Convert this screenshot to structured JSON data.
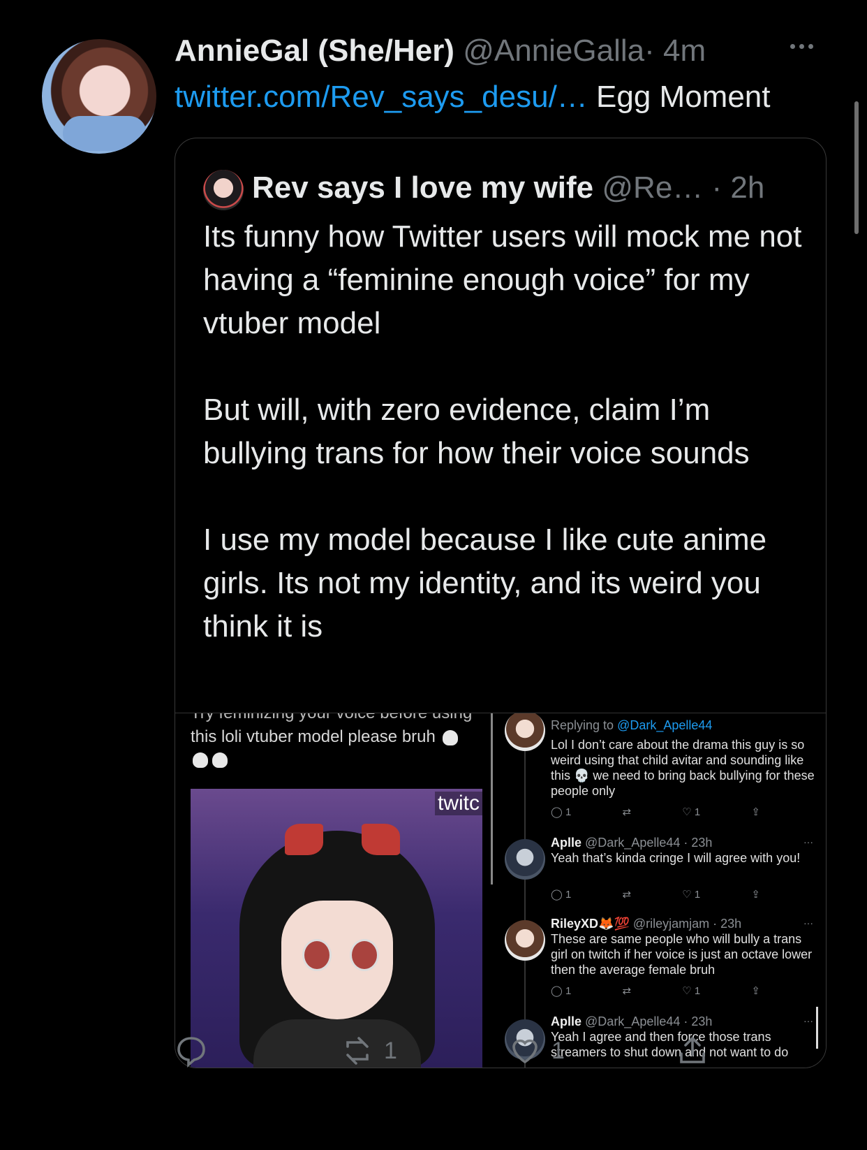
{
  "tweet": {
    "display_name": "AnnieGal (She/Her)",
    "handle": "@AnnieGalla",
    "time": "· 4m",
    "link_text": "twitter.com/Rev_says_desu/…",
    "text_after_link": "Egg Moment"
  },
  "quote": {
    "display_name": "Rev says I love my wife",
    "handle_time": "@Re… · 2h",
    "paragraphs": [
      "Its funny how Twitter users will mock me not having a “feminine enough voice” for my vtuber model",
      "But will, with zero evidence, claim I’m bullying trans for how their voice sounds",
      "I use my model because I like cute anime girls. Its not my identity, and its weird you think it is"
    ]
  },
  "embedded": {
    "left_cut_text": "Try feminizing your voice before using",
    "left_text": "this loli vtuber model please bruh",
    "stream_tag": "twitc",
    "replies": [
      {
        "name": "",
        "meta": "",
        "replying_prefix": "Replying to ",
        "replying_to": "@Dark_Apelle44",
        "text": "Lol I don’t care about the drama this guy is so weird using that child avitar and sounding like this 💀 we need to bring back bullying for these people only",
        "replies": "1",
        "retweets": "",
        "likes": "1"
      },
      {
        "name": "Aplle",
        "meta": "@Dark_Apelle44 · 23h",
        "text": "Yeah that’s kinda cringe I will agree with you!",
        "replies": "1",
        "retweets": "",
        "likes": "1"
      },
      {
        "name": "RileyXD🦊💯",
        "meta": "@rileyjamjam · 23h",
        "text": "These are same people who will bully a trans girl on twitch if her voice is just an octave lower then the average female bruh",
        "replies": "1",
        "retweets": "",
        "likes": "1"
      },
      {
        "name": "Aplle",
        "meta": "@Dark_Apelle44 · 23h",
        "text": "Yeah I agree and then force those trans streamers to shut down and not want to do"
      }
    ]
  },
  "actions": {
    "retweets": "1",
    "likes": "1"
  },
  "colors": {
    "background": "#000000",
    "link": "#1d9bf0",
    "muted": "#71767b",
    "text": "#e7e9ea"
  },
  "icons": [
    "reply-icon",
    "retweet-icon",
    "like-icon",
    "share-icon",
    "more-icon",
    "skull-emoji-icon"
  ]
}
